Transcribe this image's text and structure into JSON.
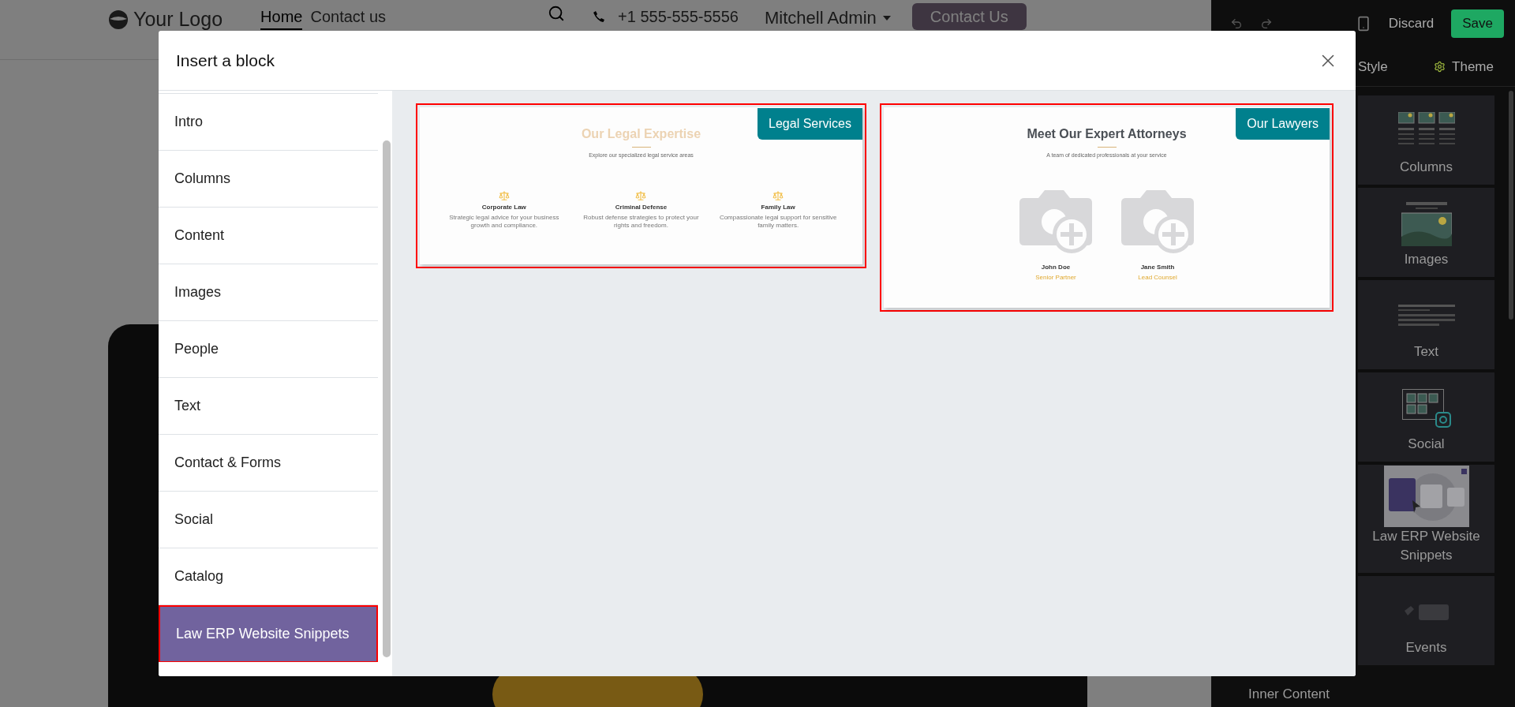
{
  "site_header": {
    "logo": "Your Logo",
    "nav": [
      {
        "label": "Home",
        "selected": true
      },
      {
        "label": "Contact us",
        "selected": false
      }
    ],
    "phone": "+1 555-555-5556",
    "user": "Mitchell Admin",
    "cta": "Contact Us"
  },
  "editor_panel": {
    "discard": "Discard",
    "save": "Save",
    "tabs": [
      {
        "label": "Style",
        "selected": false
      },
      {
        "label": "Theme",
        "selected": false
      }
    ],
    "snippets": [
      {
        "label": "Columns",
        "kind": "columns"
      },
      {
        "label": "Images",
        "kind": "images"
      },
      {
        "label": "Text",
        "kind": "text"
      },
      {
        "label": "Social",
        "kind": "social"
      },
      {
        "label": "Law ERP Website Snippets",
        "kind": "custom"
      },
      {
        "label": "Events",
        "kind": "events"
      }
    ],
    "section": "Inner Content"
  },
  "dialog": {
    "title": "Insert a block",
    "categories": [
      {
        "label": "Intro",
        "selected": false,
        "highlighted": false
      },
      {
        "label": "Columns",
        "selected": false,
        "highlighted": false
      },
      {
        "label": "Content",
        "selected": false,
        "highlighted": false
      },
      {
        "label": "Images",
        "selected": false,
        "highlighted": false
      },
      {
        "label": "People",
        "selected": false,
        "highlighted": false
      },
      {
        "label": "Text",
        "selected": false,
        "highlighted": false
      },
      {
        "label": "Contact & Forms",
        "selected": false,
        "highlighted": false
      },
      {
        "label": "Social",
        "selected": false,
        "highlighted": false
      },
      {
        "label": "Catalog",
        "selected": false,
        "highlighted": false
      },
      {
        "label": "Law ERP Website Snippets",
        "selected": true,
        "highlighted": true
      }
    ],
    "previews": [
      {
        "kind": "services",
        "tag": "Legal Services",
        "highlighted": true,
        "title": "Our Legal Expertise",
        "subtitle": "Explore our specialized legal service areas",
        "items": [
          {
            "title": "Corporate Law",
            "text": "Strategic legal advice for your business growth and compliance."
          },
          {
            "title": "Criminal Defense",
            "text": "Robust defense strategies to protect your rights and freedom."
          },
          {
            "title": "Family Law",
            "text": "Compassionate legal support for sensitive family matters."
          }
        ]
      },
      {
        "kind": "team",
        "tag": "Our Lawyers",
        "highlighted": true,
        "title": "Meet Our Expert Attorneys",
        "subtitle": "A team of dedicated professionals at your service",
        "items": [
          {
            "name": "John Doe",
            "role": "Senior Partner"
          },
          {
            "name": "Jane Smith",
            "role": "Lead Counsel"
          }
        ]
      }
    ]
  }
}
